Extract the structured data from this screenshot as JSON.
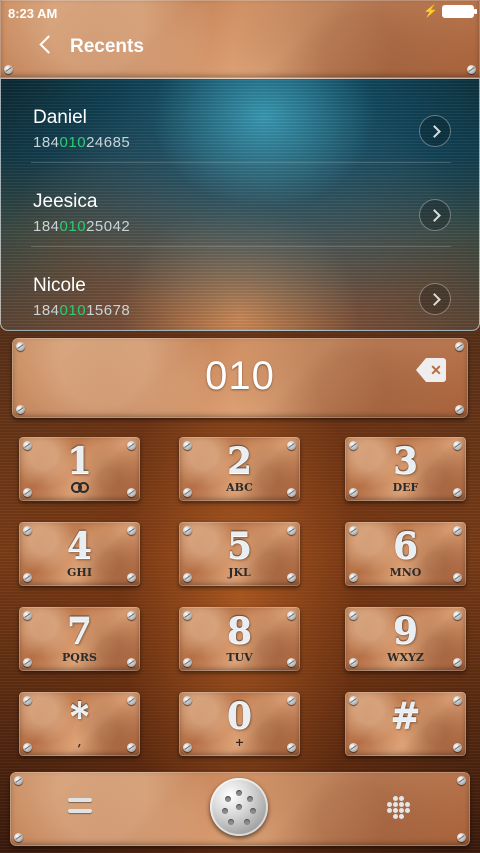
{
  "status_bar": {
    "time": "8:23 AM"
  },
  "header": {
    "title": "Recents"
  },
  "recents": [
    {
      "name": "Daniel",
      "number_prefix": "184",
      "number_match": "010",
      "number_suffix": "24685"
    },
    {
      "name": "Jeesica",
      "number_prefix": "184",
      "number_match": "010",
      "number_suffix": "25042"
    },
    {
      "name": "Nicole",
      "number_prefix": "184",
      "number_match": "010",
      "number_suffix": "15678"
    }
  ],
  "dial_input": {
    "value": "010"
  },
  "keypad": [
    {
      "digit": "1",
      "letters": ""
    },
    {
      "digit": "2",
      "letters": "ABC"
    },
    {
      "digit": "3",
      "letters": "DEF"
    },
    {
      "digit": "4",
      "letters": "GHI"
    },
    {
      "digit": "5",
      "letters": "JKL"
    },
    {
      "digit": "6",
      "letters": "MNO"
    },
    {
      "digit": "7",
      "letters": "PQRS"
    },
    {
      "digit": "8",
      "letters": "TUV"
    },
    {
      "digit": "9",
      "letters": "WXYZ"
    },
    {
      "digit": "*",
      "letters": ","
    },
    {
      "digit": "0",
      "letters": "+"
    },
    {
      "digit": "#",
      "letters": ""
    }
  ],
  "colors": {
    "match_highlight": "#2ecc71",
    "copper": "#c98a5e"
  },
  "icons": [
    "back-icon",
    "chevron-right-icon",
    "backspace-icon",
    "voicemail-icon",
    "menu-icon",
    "call-icon",
    "keypad-icon"
  ]
}
